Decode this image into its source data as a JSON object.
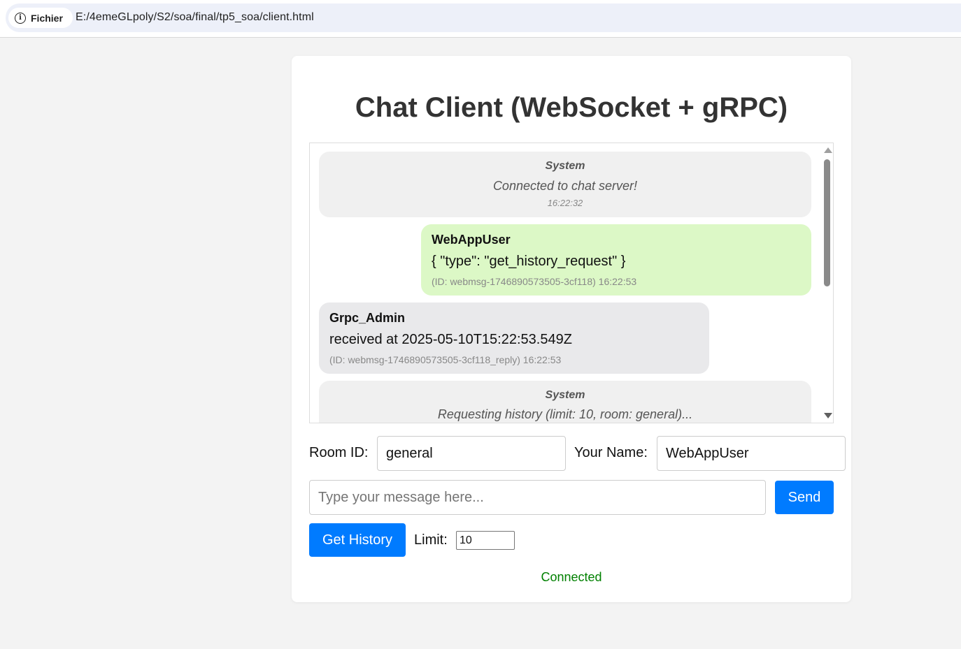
{
  "browser": {
    "site_label": "Fichier",
    "url": "E:/4emeGLpoly/S2/soa/final/tp5_soa/client.html"
  },
  "page": {
    "title": "Chat Client (WebSocket + gRPC)"
  },
  "messages": [
    {
      "kind": "system",
      "sender": "System",
      "text": "Connected to chat server!",
      "time": "16:22:32"
    },
    {
      "kind": "own",
      "sender": "WebAppUser",
      "text": "{ \"type\": \"get_history_request\" }",
      "meta": "(ID: webmsg-1746890573505-3cf118) 16:22:53"
    },
    {
      "kind": "other",
      "sender": "Grpc_Admin",
      "text": "received at 2025-05-10T15:22:53.549Z",
      "meta": "(ID: webmsg-1746890573505-3cf118_reply) 16:22:53"
    },
    {
      "kind": "system",
      "sender": "System",
      "text": "Requesting history (limit: 10, room: general)..."
    }
  ],
  "form": {
    "room_label": "Room ID:",
    "room_value": "general",
    "name_label": "Your Name:",
    "name_value": "WebAppUser",
    "message_placeholder": "Type your message here...",
    "send_label": "Send",
    "history_label": "Get History",
    "limit_label": "Limit:",
    "limit_value": "10"
  },
  "status": {
    "text": "Connected",
    "color": "#008000"
  },
  "colors": {
    "accent": "#007bff",
    "own_bubble": "#dcf8c6",
    "other_bubble": "#e9e9eb",
    "system_bubble": "#f0f0f0"
  }
}
